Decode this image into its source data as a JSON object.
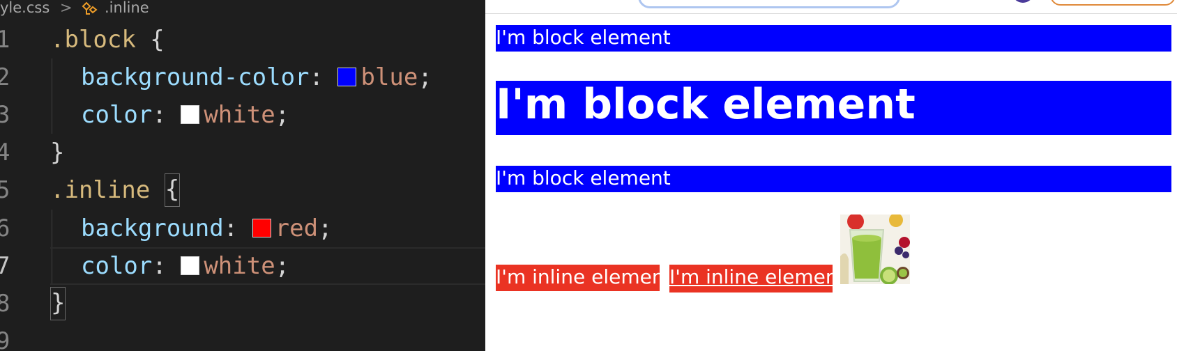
{
  "editor": {
    "breadcrumb": {
      "file": "yle.css",
      "separator": ">",
      "symbol": ".inline",
      "icon": "symbol-class-icon"
    },
    "lines": [
      {
        "num": "1",
        "selector": ".block",
        "open": " {"
      },
      {
        "num": "2",
        "prop": "background-color",
        "value": "blue",
        "swatch": "#0000ff"
      },
      {
        "num": "3",
        "prop": "color",
        "value": "white",
        "swatch": "#ffffff"
      },
      {
        "num": "4",
        "close": "}"
      },
      {
        "num": "5",
        "selector": ".inline",
        "open": "{"
      },
      {
        "num": "6",
        "prop": "background",
        "value": "red",
        "swatch": "#ff0000"
      },
      {
        "num": "7",
        "prop": "color",
        "value": "white",
        "swatch": "#ffffff"
      },
      {
        "num": "8",
        "close": "}"
      },
      {
        "num": "9"
      }
    ],
    "colon": ": ",
    "semicolon": ";"
  },
  "preview": {
    "block_text_1": "I'm block element",
    "block_text_2": "I'm block element",
    "block_text_3": "I'm block element",
    "inline_text_1": "I'm inline element",
    "inline_text_2": "I'm inline element",
    "image_alt": "green smoothie with fruits"
  },
  "colors": {
    "block_bg": "#0000ff",
    "inline_bg": "#ea3323",
    "editor_bg": "#1e1e1e"
  }
}
